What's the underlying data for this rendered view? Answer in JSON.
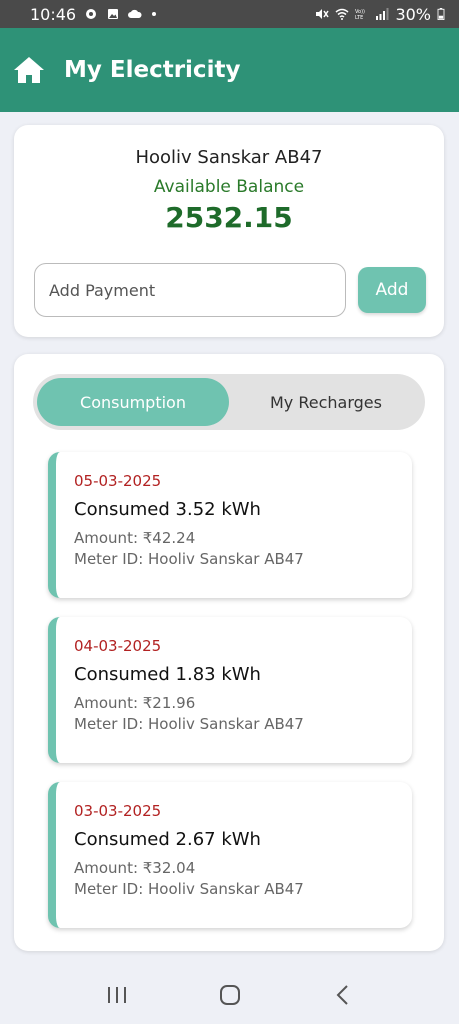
{
  "status_bar": {
    "time": "10:46",
    "battery": "30%",
    "icons": [
      "sync-icon",
      "image-icon",
      "cloud-icon",
      "mute-icon",
      "wifi-icon",
      "volte-icon",
      "signal-icon",
      "battery-icon"
    ]
  },
  "app_bar": {
    "title": "My Electricity",
    "icon": "home-icon"
  },
  "balance_card": {
    "meter_name": "Hooliv Sanskar AB47",
    "balance_label": "Available Balance",
    "balance_value": "2532.15",
    "payment_placeholder": "Add Payment",
    "payment_value": "",
    "add_label": "Add"
  },
  "tabs": {
    "consumption": "Consumption",
    "recharges": "My Recharges",
    "active": "Consumption"
  },
  "entries": [
    {
      "date": "05-03-2025",
      "consumed": "Consumed 3.52 kWh",
      "amount": "Amount: ₹42.24",
      "meter": "Meter ID: Hooliv Sanskar AB47"
    },
    {
      "date": "04-03-2025",
      "consumed": "Consumed 1.83 kWh",
      "amount": "Amount: ₹21.96",
      "meter": "Meter ID: Hooliv Sanskar AB47"
    },
    {
      "date": "03-03-2025",
      "consumed": "Consumed 2.67 kWh",
      "amount": "Amount: ₹32.04",
      "meter": "Meter ID: Hooliv Sanskar AB47"
    }
  ],
  "colors": {
    "app_bar": "#2e9277",
    "accent": "#6fc3b0",
    "balance_green": "#1e6b2a",
    "date_red": "#b22222"
  },
  "nav_bar": [
    "recents-icon",
    "home-circle-icon",
    "back-icon"
  ]
}
